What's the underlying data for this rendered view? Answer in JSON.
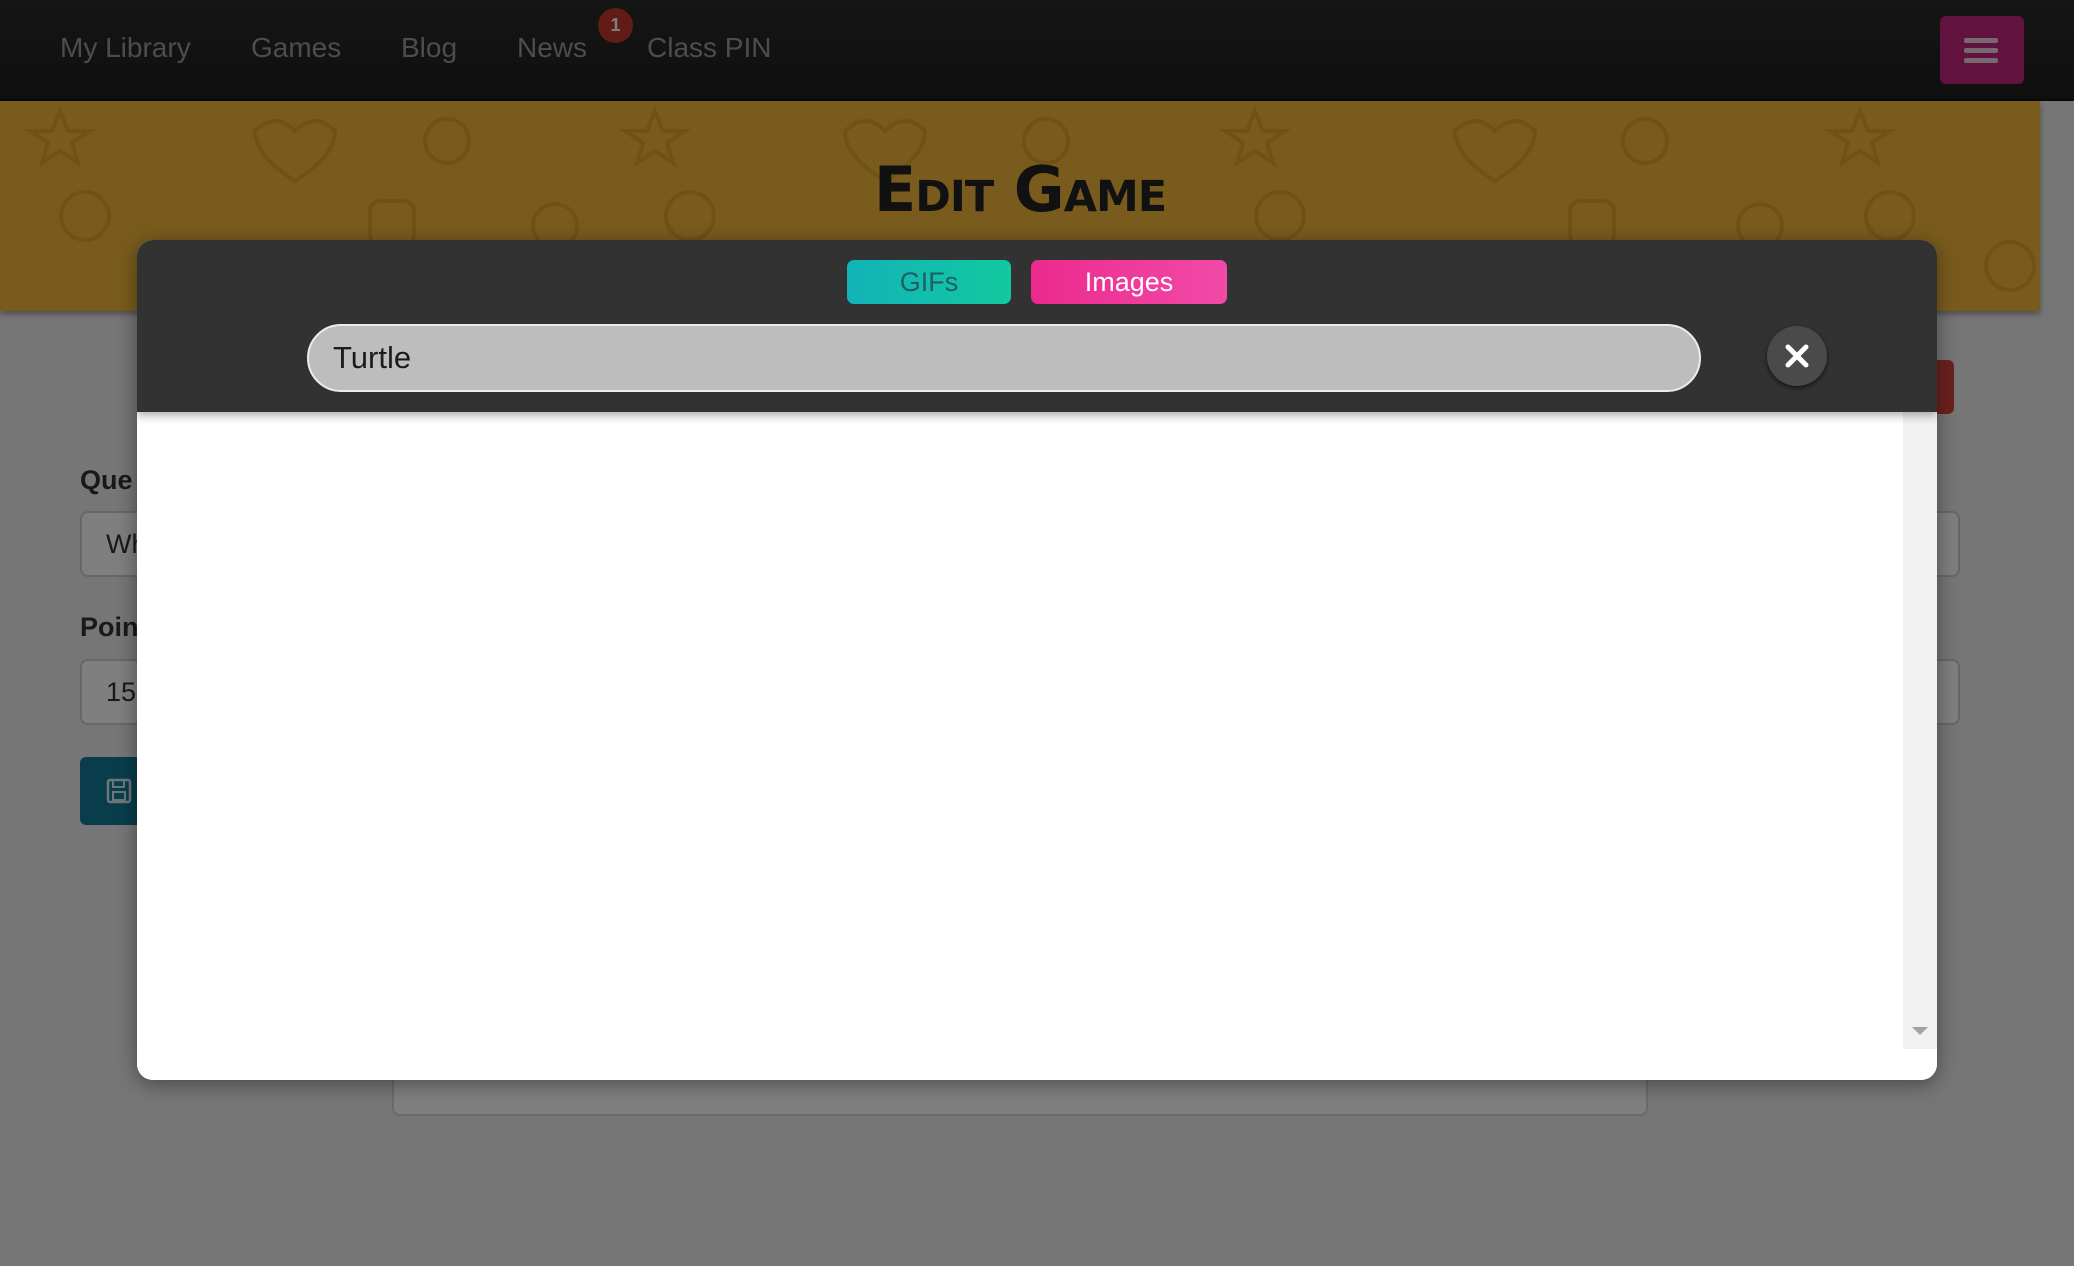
{
  "nav": {
    "items": [
      "My Library",
      "Games",
      "Blog",
      "News",
      "Class PIN"
    ],
    "news_badge": "1",
    "menu_icon": "hamburger-icon"
  },
  "hero": {
    "title": "Edit Game"
  },
  "form": {
    "question_label": "Que",
    "question_value": "Wh",
    "points_label": "Poin",
    "points_value": "15"
  },
  "modal": {
    "tabs": {
      "gifs": "GIFs",
      "images": "Images"
    },
    "active_tab": "images",
    "search_value": "Turtle",
    "close_icon": "close-icon"
  },
  "colors": {
    "nav_bg": "#1f1f1f",
    "hero_bg": "#f3b83b",
    "gifs_tab": "#12b3b8",
    "images_tab": "#ec2a8d",
    "menu_button": "#c2247f"
  }
}
